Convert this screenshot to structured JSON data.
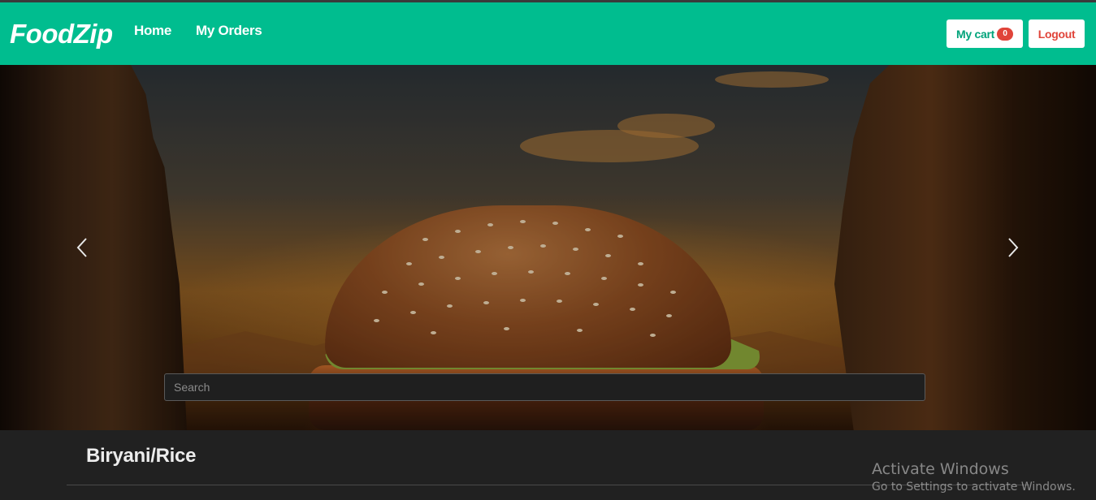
{
  "brand": "FoodZip",
  "nav": {
    "home": "Home",
    "my_orders": "My Orders"
  },
  "actions": {
    "cart_label": "My cart",
    "cart_count": "0",
    "logout_label": "Logout"
  },
  "search": {
    "placeholder": "Search",
    "value": ""
  },
  "carousel": {
    "prev_icon": "chevron-left-icon",
    "next_icon": "chevron-right-icon"
  },
  "section": {
    "title": "Biryani/Rice"
  },
  "watermark": {
    "title": "Activate Windows",
    "subtitle": "Go to Settings to activate Windows."
  },
  "colors": {
    "navbar": "#00bd8f",
    "badge": "#e0443a",
    "page_background": "#212121"
  }
}
